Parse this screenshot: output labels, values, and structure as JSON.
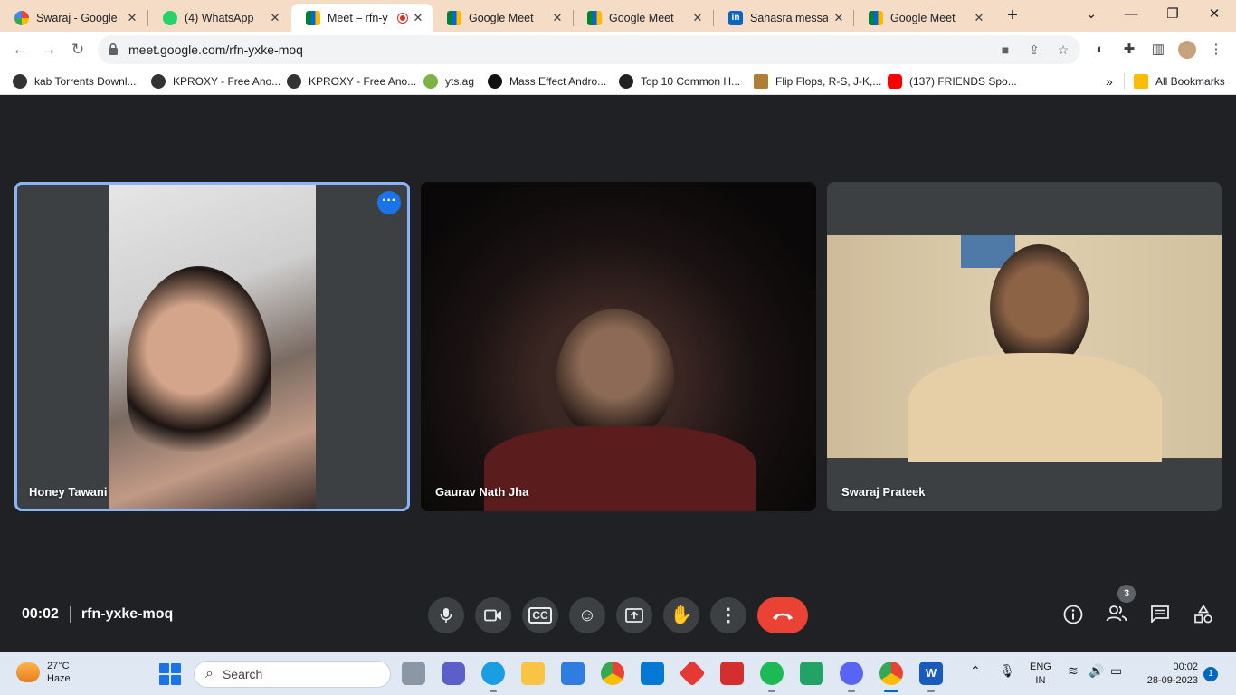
{
  "browser": {
    "tabs": [
      {
        "title": "Swaraj - Google",
        "icon": "google-icon",
        "active": false
      },
      {
        "title": "(4) WhatsApp",
        "icon": "whatsapp-icon",
        "active": false
      },
      {
        "title": "Meet – rfn-y",
        "icon": "meet-icon",
        "active": true,
        "recording": true
      },
      {
        "title": "Google Meet",
        "icon": "meet-icon",
        "active": false
      },
      {
        "title": "Google Meet",
        "icon": "meet-icon",
        "active": false
      },
      {
        "title": "Sahasra messag",
        "icon": "linkedin-icon",
        "active": false
      },
      {
        "title": "Google Meet",
        "icon": "meet-icon",
        "active": false
      }
    ],
    "url": "meet.google.com/rfn-yxke-moq",
    "bookmarks": [
      "kab Torrents Downl...",
      "KPROXY - Free Ano...",
      "KPROXY - Free Ano...",
      "yts.ag",
      "Mass Effect Andro...",
      "Top 10 Common H...",
      "Flip Flops, R-S, J-K,...",
      "(137) FRIENDS Spo..."
    ],
    "all_bookmarks": "All Bookmarks",
    "overflow": "»"
  },
  "meet": {
    "participants": [
      {
        "name": "Honey Tawani",
        "active": true
      },
      {
        "name": "Gaurav Nath Jha",
        "active": false
      },
      {
        "name": "Swaraj Prateek",
        "active": false
      }
    ],
    "time": "00:02",
    "meeting_code": "rfn-yxke-moq",
    "people_count": "3",
    "controls": [
      "mic-icon",
      "camera-icon",
      "captions-icon",
      "emoji-icon",
      "present-icon",
      "raise-hand-icon",
      "more-options-icon",
      "end-call-icon"
    ],
    "side_controls": [
      "info-icon",
      "people-icon",
      "chat-icon",
      "activities-icon"
    ],
    "colors": {
      "background": "#202124",
      "tile": "#3c4043",
      "end_call": "#ea4335",
      "active_outline": "#8ab4f8"
    }
  },
  "taskbar": {
    "weather_temp": "27°C",
    "weather_desc": "Haze",
    "search_placeholder": "Search",
    "lang_top": "ENG",
    "lang_bottom": "IN",
    "time": "00:02",
    "date": "28-09-2023",
    "notifications": "1"
  }
}
